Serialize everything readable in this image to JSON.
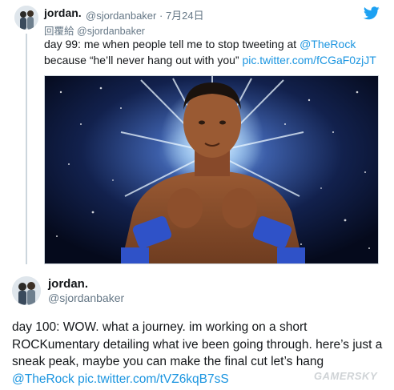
{
  "tweet1": {
    "name": "jordan.",
    "handle": "@sjordanbaker",
    "separator": "·",
    "date": "7月24日",
    "reply_prefix": "回覆給",
    "reply_to": "@sjordanbaker",
    "text_a": "day 99: me when people tell me to stop tweeting at ",
    "mention": "@TheRock",
    "text_b": "because “he’ll never hang out with you” ",
    "link": "pic.twitter.com/fCGaF0zjJT"
  },
  "tweet2": {
    "name": "jordan.",
    "handle": "@sjordanbaker",
    "text": "day 100: WOW. what a journey. im working on a short ROCKumentary detailing what ive been going through. here’s just a sneak peak, maybe you can make the final cut  let’s hang ",
    "mention": "@TheRock",
    "link": "pic.twitter.com/tVZ6kqB7sS"
  },
  "icons": {
    "brand": "twitter-bird-icon",
    "brand_color": "#1da1f2",
    "link_color": "#1b95e0"
  },
  "watermark": "GAMERSKY"
}
